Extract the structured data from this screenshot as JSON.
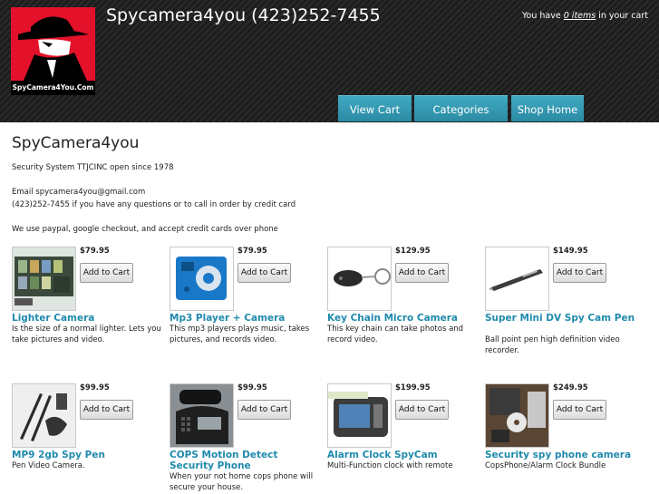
{
  "header": {
    "logo_text": "SpyCamera4You.Com",
    "site_title": "Spycamera4you (423)252-7455",
    "cart_prefix": "You have",
    "cart_link": "0 items",
    "cart_suffix": "in your cart"
  },
  "nav": {
    "view_cart": "View Cart",
    "categories": "Categories",
    "shop_home": "Shop Home"
  },
  "intro": {
    "heading": "SpyCamera4you",
    "line1": "Security System TTJCINC open since 1978",
    "line2": "Email spycamera4you@gmail.com",
    "line3": "(423)252-7455 if you have any questions or to call in order by credit card",
    "line4": "We use paypal, google checkout, and accept credit cards over phone"
  },
  "products": [
    {
      "name": "Lighter Camera",
      "price": "$79.95",
      "button": "Add to Cart",
      "desc": "Is the size of a normal lighter. Lets you take pictures and video.",
      "icon": "lighter-camera-icon"
    },
    {
      "name": "Mp3 Player + Camera",
      "price": "$79.95",
      "button": "Add to Cart",
      "desc": "This mp3 players plays music, takes pictures, and records video.",
      "icon": "mp3-player-icon"
    },
    {
      "name": "Key Chain Micro Camera",
      "price": "$129.95",
      "button": "Add to Cart",
      "desc": "This key chain can take photos and record video.",
      "icon": "key-chain-camera-icon"
    },
    {
      "name": "Super Mini DV Spy Cam Pen",
      "price": "$149.95",
      "button": "Add to Cart",
      "desc": "Ball point pen high definition video recorder.",
      "icon": "spy-pen-icon"
    },
    {
      "name": "MP9 2gb Spy Pen",
      "price": "$99.95",
      "button": "Add to Cart",
      "desc": "Pen Video Camera.",
      "icon": "spy-pen-kit-icon"
    },
    {
      "name": "COPS Motion Detect Security Phone",
      "price": "$99.95",
      "button": "Add to Cart",
      "desc": "When your not home cops phone will secure your house.",
      "icon": "security-phone-icon"
    },
    {
      "name": "Alarm Clock SpyCam",
      "price": "$199.95",
      "button": "Add to Cart",
      "desc": "Multi-Function clock with remote",
      "icon": "alarm-clock-icon"
    },
    {
      "name": "Security spy phone camera",
      "price": "$249.95",
      "button": "Add to Cart",
      "desc": "CopsPhone/Alarm Clock Bundle",
      "icon": "spy-phone-bundle-icon"
    }
  ]
}
